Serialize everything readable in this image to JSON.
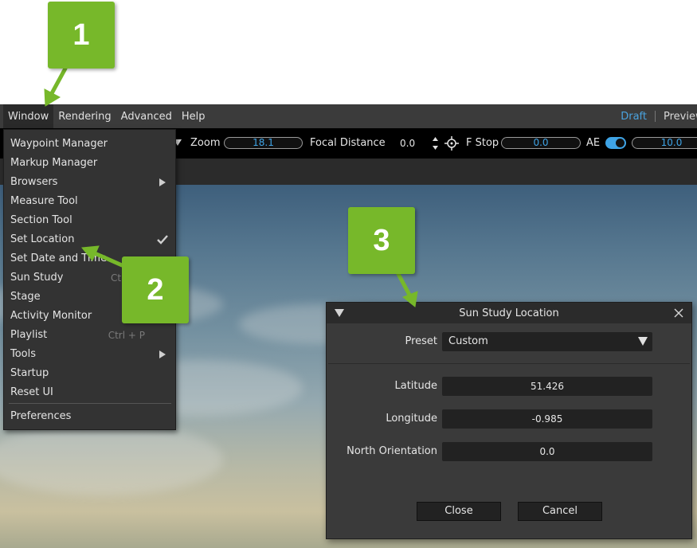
{
  "callouts": {
    "one": "1",
    "two": "2",
    "three": "3"
  },
  "menubar": {
    "items": [
      "Window",
      "Rendering",
      "Advanced",
      "Help"
    ],
    "modes": {
      "draft": "Draft",
      "preview": "Preview"
    }
  },
  "toolbar": {
    "zoom_label": "Zoom",
    "zoom_value": "18.1",
    "focal_label": "Focal Distance",
    "focal_value": "0.0",
    "fstop_label": "F Stop",
    "fstop_value": "0.0",
    "ae_label": "AE",
    "ae_enabled": true,
    "exposure_value": "10.0"
  },
  "window_menu": {
    "items": [
      {
        "label": "Waypoint Manager"
      },
      {
        "label": "Markup Manager"
      },
      {
        "label": "Browsers",
        "submenu": true
      },
      {
        "label": "Measure Tool"
      },
      {
        "label": "Section Tool"
      },
      {
        "label": "Set Location",
        "checked": true
      },
      {
        "label": "Set Date and Time"
      },
      {
        "label": "Sun Study",
        "shortcut": "Ctrl"
      },
      {
        "label": "Stage"
      },
      {
        "label": "Activity Monitor"
      },
      {
        "label": "Playlist",
        "shortcut": "Ctrl + P"
      },
      {
        "label": "Tools",
        "submenu": true
      },
      {
        "label": "Startup"
      },
      {
        "label": "Reset UI"
      },
      {
        "label": "Preferences"
      }
    ]
  },
  "dialog": {
    "title": "Sun Study Location",
    "preset_label": "Preset",
    "preset_value": "Custom",
    "latitude_label": "Latitude",
    "latitude_value": "51.426",
    "longitude_label": "Longitude",
    "longitude_value": "-0.985",
    "north_label": "North Orientation",
    "north_value": "0.0",
    "close_label": "Close",
    "cancel_label": "Cancel"
  },
  "colors": {
    "callout": "#77b82a",
    "accent": "#3fa4e6",
    "draft": "#4aa3df"
  }
}
